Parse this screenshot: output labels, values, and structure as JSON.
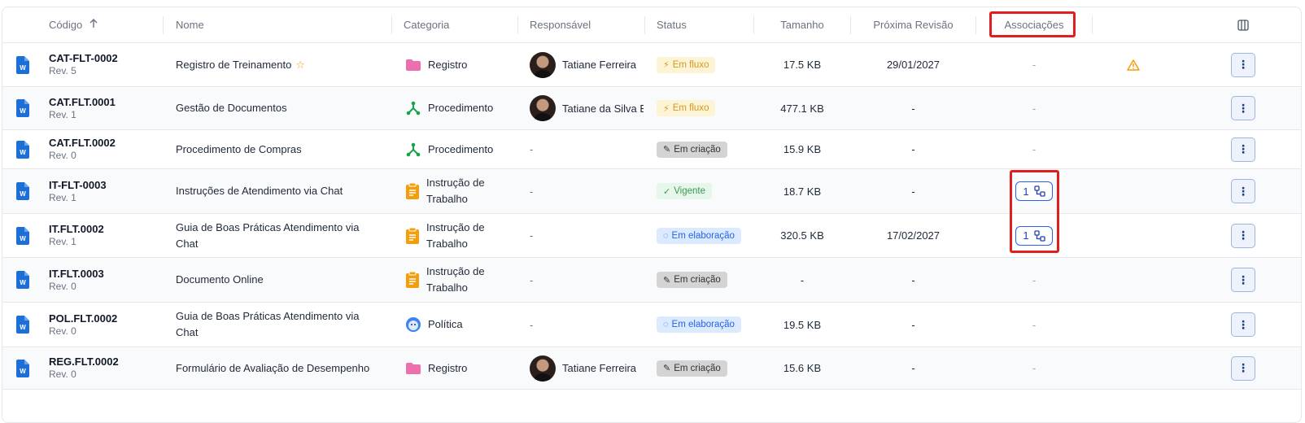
{
  "columns": {
    "codigo": "Código",
    "sort_icon": "arrow-up-icon",
    "nome": "Nome",
    "categoria": "Categoria",
    "responsavel": "Responsável",
    "status": "Status",
    "tamanho": "Tamanho",
    "proxima_revisao": "Próxima Revisão",
    "associacoes": "Associações",
    "columns_icon": "columns-icon"
  },
  "rows": [
    {
      "code": "CAT-FLT-0002",
      "rev": "Rev. 5",
      "name": "Registro de Treinamento",
      "starred": true,
      "category": "Registro",
      "category_icon": "folder-icon",
      "responsible": "Tatiane Ferreira",
      "has_avatar": true,
      "status": "Em fluxo",
      "status_type": "fluxo",
      "size": "17.5 KB",
      "next_review": "29/01/2027",
      "assoc": "-",
      "warning": true
    },
    {
      "code": "CAT.FLT.0001",
      "rev": "Rev. 1",
      "name": "Gestão de Documentos",
      "starred": false,
      "category": "Procedimento",
      "category_icon": "branch-icon",
      "responsible": "Tatiane da Silva E",
      "has_avatar": true,
      "status": "Em fluxo",
      "status_type": "fluxo",
      "size": "477.1 KB",
      "next_review": "-",
      "assoc": "-",
      "warning": false
    },
    {
      "code": "CAT.FLT.0002",
      "rev": "Rev. 0",
      "name": "Procedimento de Compras",
      "starred": false,
      "category": "Procedimento",
      "category_icon": "branch-icon",
      "responsible": "-",
      "has_avatar": false,
      "status": "Em criação",
      "status_type": "criacao",
      "size": "15.9 KB",
      "next_review": "-",
      "assoc": "-",
      "warning": false
    },
    {
      "code": "IT-FLT-0003",
      "rev": "Rev. 1",
      "name": "Instruções de Atendimento via Chat",
      "starred": false,
      "category": "Instrução de Trabalho",
      "category_icon": "clipboard-icon",
      "responsible": "-",
      "has_avatar": false,
      "status": "Vigente",
      "status_type": "vigente",
      "size": "18.7 KB",
      "next_review": "-",
      "assoc": "1",
      "warning": false
    },
    {
      "code": "IT.FLT.0002",
      "rev": "Rev. 1",
      "name": "Guia de Boas Práticas Atendimento via Chat",
      "starred": false,
      "category": "Instrução de Trabalho",
      "category_icon": "clipboard-icon",
      "responsible": "-",
      "has_avatar": false,
      "status": "Em elaboração",
      "status_type": "elab",
      "size": "320.5 KB",
      "next_review": "17/02/2027",
      "assoc": "1",
      "warning": false
    },
    {
      "code": "IT.FLT.0003",
      "rev": "Rev. 0",
      "name": "Documento Online",
      "starred": false,
      "category": "Instrução de Trabalho",
      "category_icon": "clipboard-icon",
      "responsible": "-",
      "has_avatar": false,
      "status": "Em criação",
      "status_type": "criacao",
      "size": "-",
      "next_review": "-",
      "assoc": "-",
      "warning": false
    },
    {
      "code": "POL.FLT.0002",
      "rev": "Rev. 0",
      "name": "Guia de Boas Práticas Atendimento via Chat",
      "starred": false,
      "category": "Política",
      "category_icon": "face-icon",
      "responsible": "-",
      "has_avatar": false,
      "status": "Em elaboração",
      "status_type": "elab",
      "size": "19.5 KB",
      "next_review": "-",
      "assoc": "-",
      "warning": false
    },
    {
      "code": "REG.FLT.0002",
      "rev": "Rev. 0",
      "name": "Formulário de Avaliação de Desempenho",
      "starred": false,
      "category": "Registro",
      "category_icon": "folder-icon",
      "responsible": "Tatiane Ferreira",
      "has_avatar": true,
      "status": "Em criação",
      "status_type": "criacao",
      "size": "15.6 KB",
      "next_review": "-",
      "assoc": "-",
      "warning": false
    }
  ],
  "colors": {
    "accent": "#2563eb",
    "highlight": "#e11d1d",
    "warning": "#f59e0b"
  }
}
